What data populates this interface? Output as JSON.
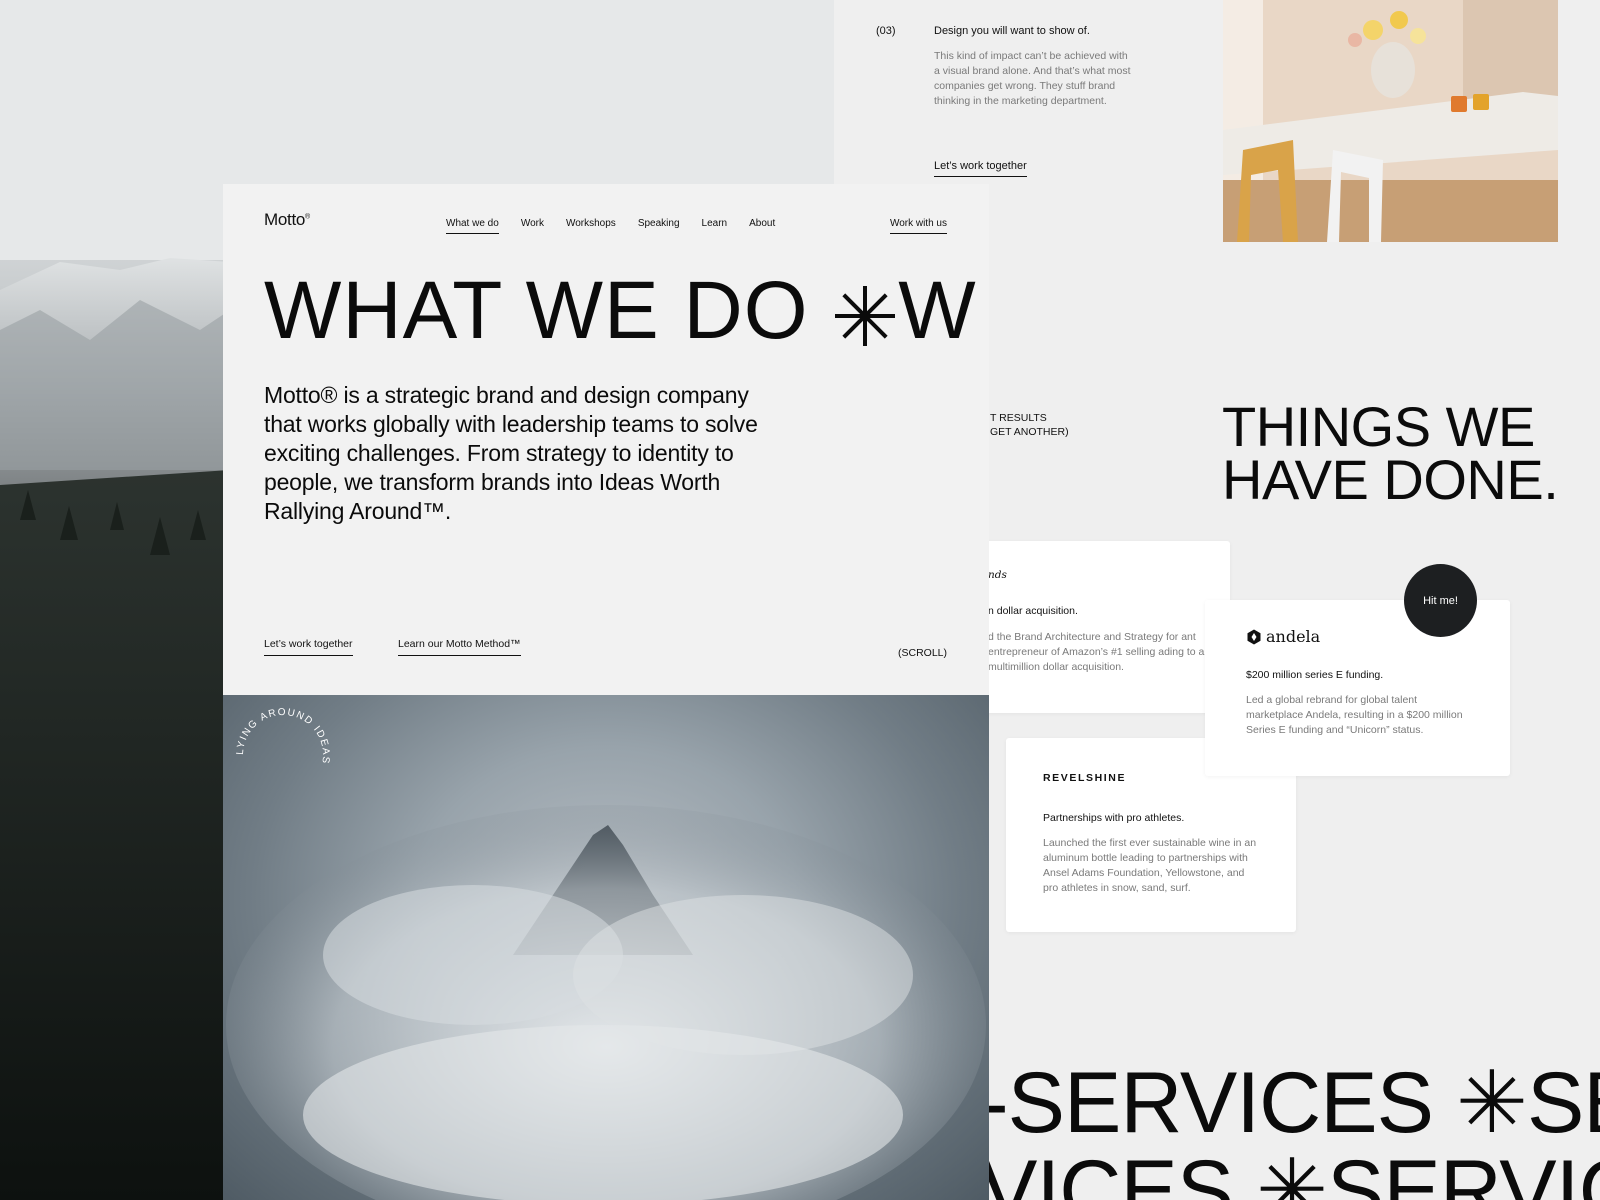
{
  "step": {
    "number": "(03)",
    "title": "Design you will want to show of.",
    "description": "This kind of impact can’t be achieved with a visual brand alone. And that’s what most companies get wrong. They stuff brand thinking in the marketing department.",
    "cta": "Let’s work together"
  },
  "things": {
    "title_line1": "THINGS WE",
    "title_line2": "HAVE DONE.",
    "results_line1": "T RESULTS",
    "results_line2": "GET ANOTHER)"
  },
  "cards": [
    {
      "logo": "nds",
      "headline": "n dollar acquisition.",
      "text": "d the Brand Architecture and Strategy for ant entrepreneur of Amazon’s #1 selling ading to a multimillion dollar acquisition."
    },
    {
      "logo": "andela",
      "headline": "$200 million series E funding.",
      "text": "Led a global rebrand for global talent marketplace Andela, resulting in a $200 million Series E funding and “Unicorn” status."
    },
    {
      "logo": "REVELSHINE",
      "headline": "Partnerships with pro athletes.",
      "text": "Launched the first ever sustainable wine in an aluminum bottle leading to partnerships with Ansel Adams Foundation, Yellowstone, and pro athletes in snow, sand, surf."
    }
  ],
  "hit_me": "Hit me!",
  "services": {
    "line1": "-SERVICES ✳SER",
    "line2": "VICES ✳SERVICE"
  },
  "site": {
    "logo": "Motto",
    "logo_mark": "®",
    "nav": [
      "What we do",
      "Work",
      "Workshops",
      "Speaking",
      "Learn",
      "About"
    ],
    "nav_active": "What we do",
    "nav_cta": "Work with us",
    "hero_title": "WHAT WE DO",
    "hero_title_tail": "W",
    "hero_copy": "Motto® is a strategic brand and design company that works globally with leadership teams to solve exciting challenges. From strategy to identity to people, we transform brands into Ideas Worth Rallying Around™.",
    "link1": "Let’s work together",
    "link2": "Learn our Motto Method™",
    "scroll": "(SCROLL)"
  },
  "badge_text": "LYING AROUND IDEAS",
  "colors": {
    "dark_badge": "#1d1f21",
    "muted_text": "#7a7a7a",
    "panel_bg": "#f2f2f2"
  }
}
